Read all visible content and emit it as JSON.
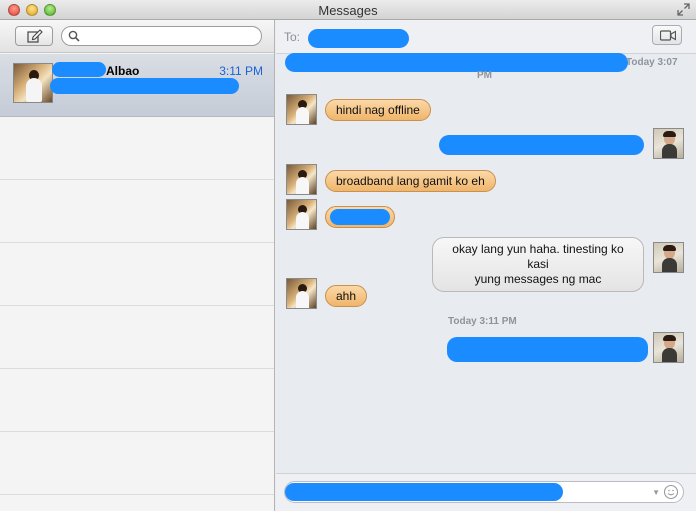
{
  "window": {
    "title": "Messages"
  },
  "sidebar": {
    "search": {
      "placeholder": ""
    },
    "conversations": [
      {
        "name": "Albao",
        "time": "3:11 PM",
        "selected": true
      }
    ]
  },
  "chat": {
    "to_label": "To:",
    "header_timestamp_day": "Today 3:07",
    "header_timestamp_time": "PM",
    "messages": [
      {
        "direction": "incoming",
        "text": "hindi nag offline"
      },
      {
        "direction": "outgoing",
        "text": ""
      },
      {
        "direction": "incoming",
        "text": "broadband lang gamit ko eh"
      },
      {
        "direction": "incoming",
        "text": ""
      },
      {
        "direction": "outgoing",
        "text": "okay lang yun haha. tinesting ko kasi yung messages ng mac",
        "line1": "okay lang yun haha. tinesting ko kasi",
        "line2": "yung messages ng mac"
      },
      {
        "direction": "incoming",
        "text": "ahh"
      },
      {
        "direction": "outgoing",
        "text": ""
      }
    ],
    "mid_timestamp": "Today 3:11 PM",
    "input": {
      "placeholder": ""
    }
  },
  "colors": {
    "redaction": "#1a8cff",
    "incoming_bubble": "#f0b56a",
    "outgoing_bubble": "#e4e4e4",
    "timestamp_blue": "#1a63d6"
  },
  "icons": [
    "close-icon",
    "minimize-icon",
    "zoom-icon",
    "fullscreen-icon",
    "compose-icon",
    "search-icon",
    "video-camera-icon",
    "emoji-icon"
  ]
}
